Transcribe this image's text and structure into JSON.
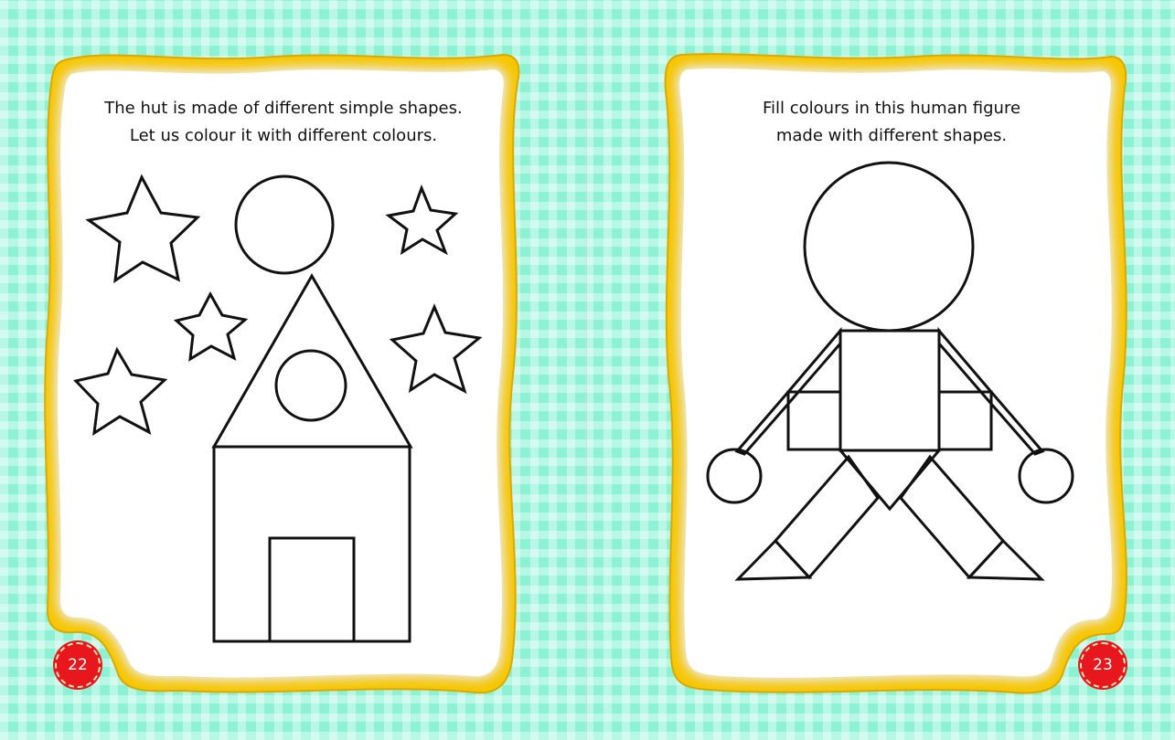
{
  "left_page": {
    "instruction_lines": [
      "The hut is made of different simple shapes.",
      "Let us colour it with different colours."
    ],
    "page_number": "22",
    "figure": "hut with stars and circle sun",
    "shapes": [
      "star",
      "circle",
      "star",
      "star",
      "star",
      "star",
      "triangle-roof",
      "circle-window",
      "rectangle-wall",
      "rectangle-door"
    ]
  },
  "right_page": {
    "instruction_lines": [
      "Fill colours in this human figure",
      "made with different shapes."
    ],
    "page_number": "23",
    "figure": "human figure made of shapes",
    "shapes": [
      "circle-head",
      "square-body",
      "rectangle-arm",
      "rectangle-arm",
      "circle-hand",
      "circle-hand",
      "triangle",
      "rectangle-leg",
      "rectangle-leg",
      "triangle-foot",
      "triangle-foot"
    ]
  },
  "colors": {
    "background": "#8df2d4",
    "frame_border": "#f7c600",
    "page_fill": "#ffffff",
    "badge_fill": "#e8161d",
    "outline": "#111111"
  }
}
